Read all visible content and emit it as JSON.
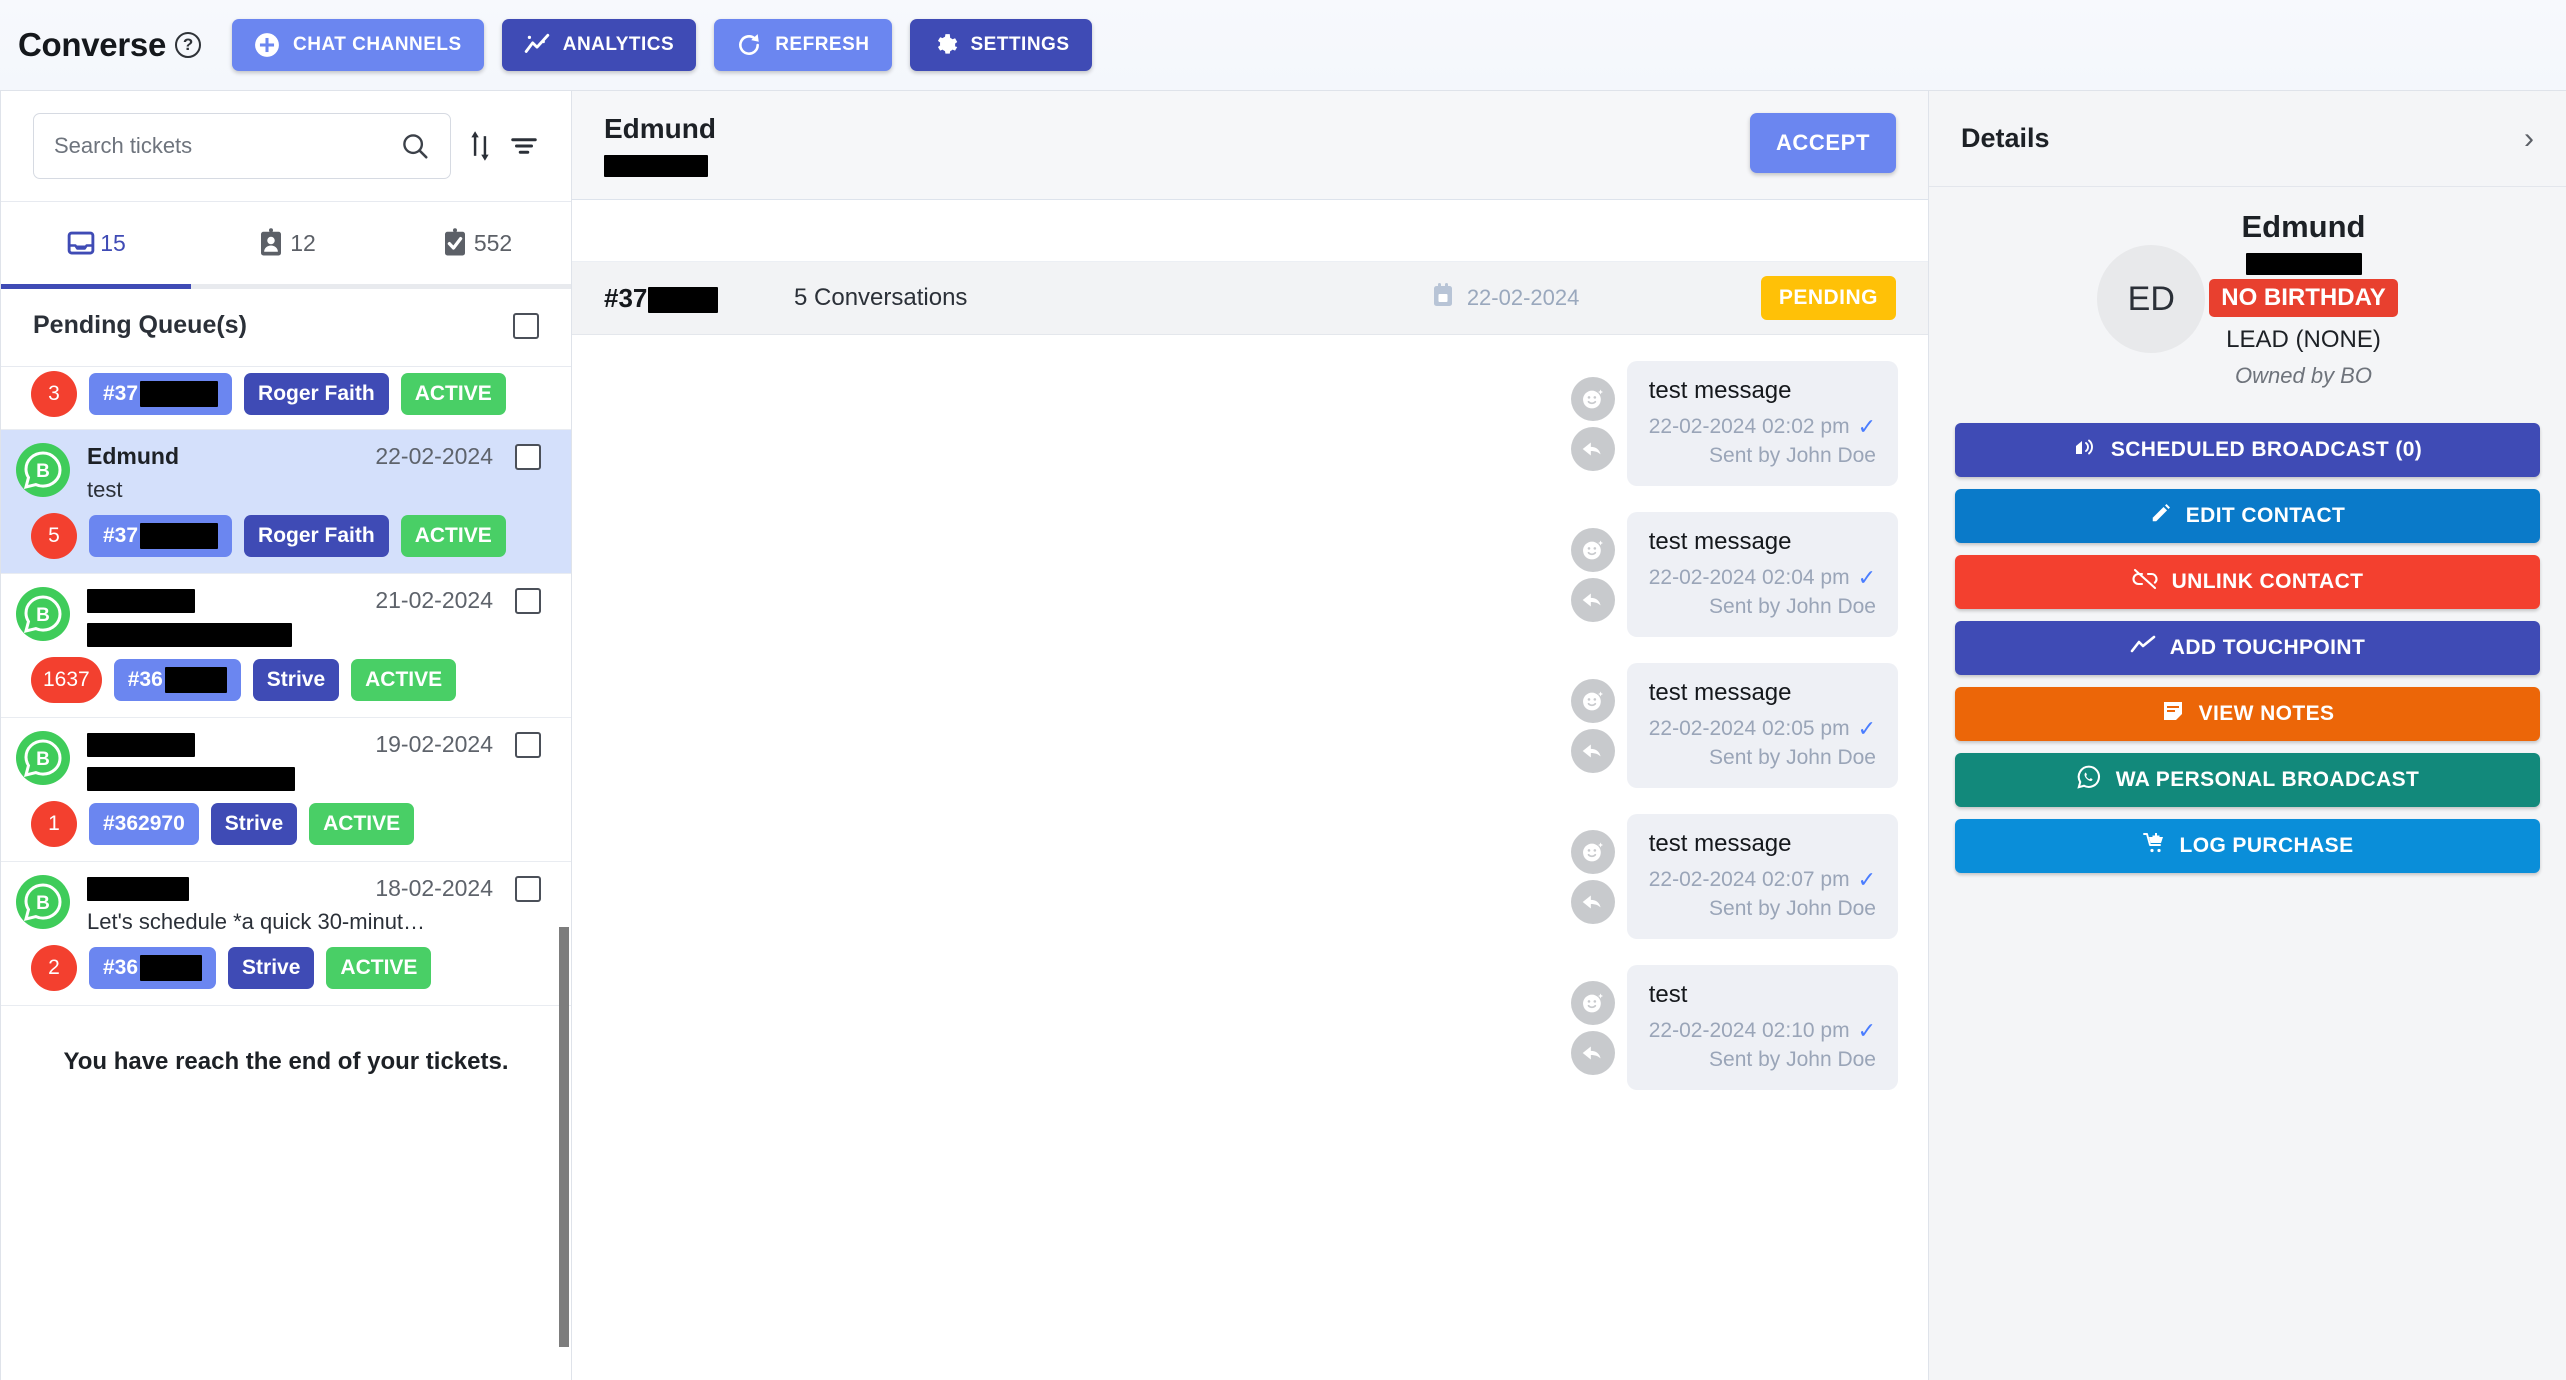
{
  "header": {
    "brand": "Converse",
    "help_icon": "question-circle-icon",
    "buttons": [
      {
        "label": "CHAT CHANNELS",
        "icon": "plus-circle-icon",
        "style": "light"
      },
      {
        "label": "ANALYTICS",
        "icon": "analytics-icon",
        "style": "dark"
      },
      {
        "label": "REFRESH",
        "icon": "refresh-icon",
        "style": "light"
      },
      {
        "label": "SETTINGS",
        "icon": "gear-icon",
        "style": "dark"
      }
    ]
  },
  "sidebar": {
    "search": {
      "placeholder": "Search tickets",
      "value": "",
      "search_icon": "search-icon",
      "sort_icon": "sort-icon",
      "filter_icon": "filter-icon"
    },
    "tabs": [
      {
        "icon": "inbox-icon",
        "count": "15",
        "active": true
      },
      {
        "icon": "contact-card-icon",
        "count": "12",
        "active": false
      },
      {
        "icon": "clipboard-check-icon",
        "count": "552",
        "active": false
      }
    ],
    "queue_title": "Pending Queue(s)",
    "select_all_checkbox": "unchecked",
    "tickets": [
      {
        "redacted_top": true,
        "name": "",
        "name_redacted_w": 0,
        "date": "",
        "snippet": "",
        "snippet_redacted_w": 0,
        "count": "3",
        "id": "#37",
        "id_redacted_w": 78,
        "team": "Roger Faith",
        "status": "ACTIVE",
        "selected": false,
        "partial": true
      },
      {
        "name": "Edmund",
        "name_redacted_w": 0,
        "date": "22-02-2024",
        "snippet": "test",
        "snippet_redacted_w": 0,
        "count": "5",
        "id": "#37",
        "id_redacted_w": 78,
        "team": "Roger Faith",
        "status": "ACTIVE",
        "selected": true,
        "partial": false
      },
      {
        "name": "",
        "name_redacted_w": 108,
        "date": "21-02-2024",
        "snippet": "",
        "snippet_redacted_w": 205,
        "count": "1637",
        "id": "#36",
        "id_redacted_w": 62,
        "team": "Strive",
        "status": "ACTIVE",
        "selected": false,
        "partial": false
      },
      {
        "name": "",
        "name_redacted_w": 108,
        "date": "19-02-2024",
        "snippet": "",
        "snippet_redacted_w": 208,
        "count": "1",
        "id": "#362970",
        "id_redacted_w": 0,
        "team": "Strive",
        "status": "ACTIVE",
        "selected": false,
        "partial": false
      },
      {
        "name": "",
        "name_redacted_w": 102,
        "date": "18-02-2024",
        "snippet": "Let's schedule *a quick 30-minut…",
        "snippet_redacted_w": 0,
        "count": "2",
        "id": "#36",
        "id_redacted_w": 62,
        "team": "Strive",
        "status": "ACTIVE",
        "selected": false,
        "partial": false
      }
    ],
    "end_message": "You have reach the end of your tickets."
  },
  "ticket": {
    "name": "Edmund",
    "subtitle_redacted": true,
    "accept_label": "ACCEPT",
    "conversation": {
      "id": "#37",
      "id_redacted": true,
      "count_label": "5 Conversations",
      "date": "22-02-2024",
      "calendar_icon": "calendar-icon",
      "status": "PENDING"
    },
    "messages": [
      {
        "text": "test message",
        "timestamp": "22-02-2024 02:02 pm",
        "sender": "Sent by John Doe",
        "delivered": true
      },
      {
        "text": "test message",
        "timestamp": "22-02-2024 02:04 pm",
        "sender": "Sent by John Doe",
        "delivered": true
      },
      {
        "text": "test message",
        "timestamp": "22-02-2024 02:05 pm",
        "sender": "Sent by John Doe",
        "delivered": true
      },
      {
        "text": "test message",
        "timestamp": "22-02-2024 02:07 pm",
        "sender": "Sent by John Doe",
        "delivered": true
      },
      {
        "text": "test",
        "timestamp": "22-02-2024 02:10 pm",
        "sender": "Sent by John Doe",
        "delivered": true
      }
    ],
    "message_icons": {
      "react": "emoji-react-icon",
      "reply": "reply-icon",
      "delivered": "check-icon"
    }
  },
  "details": {
    "title": "Details",
    "expand_icon": "chevron-right-icon",
    "contact": {
      "initials": "ED",
      "name": "Edmund",
      "phone_redacted": true,
      "birthday_badge": "NO BIRTHDAY",
      "lead": "LEAD (NONE)",
      "owner": "Owned by BO"
    },
    "actions": [
      {
        "label": "SCHEDULED BROADCAST (0)",
        "icon": "broadcast-icon",
        "color": "#3f4bb5"
      },
      {
        "label": "EDIT CONTACT",
        "icon": "pencil-icon",
        "color": "#0a7ac9"
      },
      {
        "label": "UNLINK CONTACT",
        "icon": "unlink-icon",
        "color": "#f3402f"
      },
      {
        "label": "ADD TOUCHPOINT",
        "icon": "trend-icon",
        "color": "#3f4bb5"
      },
      {
        "label": "VIEW NOTES",
        "icon": "note-icon",
        "color": "#ec6608"
      },
      {
        "label": "WA PERSONAL BROADCAST",
        "icon": "whatsapp-icon",
        "color": "#12897b"
      },
      {
        "label": "LOG PURCHASE",
        "icon": "cart-plus-icon",
        "color": "#0a8ed9"
      }
    ]
  },
  "colors": {
    "accent": "#3f4bb5",
    "accent_light": "#6b86f0",
    "pending": "#ffc107",
    "active": "#49cf66",
    "danger": "#f3402f",
    "selected_row": "#d4e0fb"
  }
}
